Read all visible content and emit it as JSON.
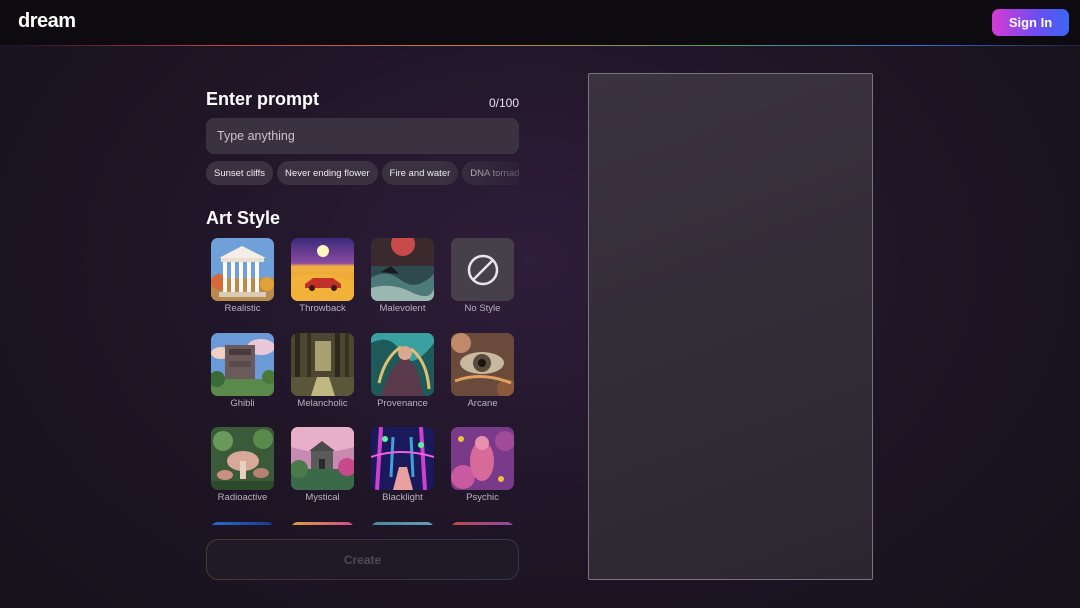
{
  "header": {
    "logo": "dream",
    "signin_label": "Sign In"
  },
  "prompt": {
    "title": "Enter prompt",
    "counter": "0/100",
    "placeholder": "Type anything",
    "value": "",
    "suggestions": [
      "Sunset cliffs",
      "Never ending flower",
      "Fire and water",
      "DNA tornado"
    ]
  },
  "art_style": {
    "title": "Art Style",
    "styles": [
      {
        "label": "Realistic",
        "icon": "realistic-thumbnail"
      },
      {
        "label": "Throwback",
        "icon": "throwback-thumbnail"
      },
      {
        "label": "Malevolent",
        "icon": "malevolent-thumbnail"
      },
      {
        "label": "No Style",
        "icon": "no-style-icon"
      },
      {
        "label": "Ghibli",
        "icon": "ghibli-thumbnail"
      },
      {
        "label": "Melancholic",
        "icon": "melancholic-thumbnail"
      },
      {
        "label": "Provenance",
        "icon": "provenance-thumbnail"
      },
      {
        "label": "Arcane",
        "icon": "arcane-thumbnail"
      },
      {
        "label": "Radioactive",
        "icon": "radioactive-thumbnail"
      },
      {
        "label": "Mystical",
        "icon": "mystical-thumbnail"
      },
      {
        "label": "Blacklight",
        "icon": "blacklight-thumbnail"
      },
      {
        "label": "Psychic",
        "icon": "psychic-thumbnail"
      }
    ]
  },
  "create_label": "Create",
  "colors": {
    "accent_gradient_start": "#d63ad6",
    "accent_gradient_end": "#3b66f5",
    "background": "#1e1526",
    "input_background": "#3a3141"
  }
}
